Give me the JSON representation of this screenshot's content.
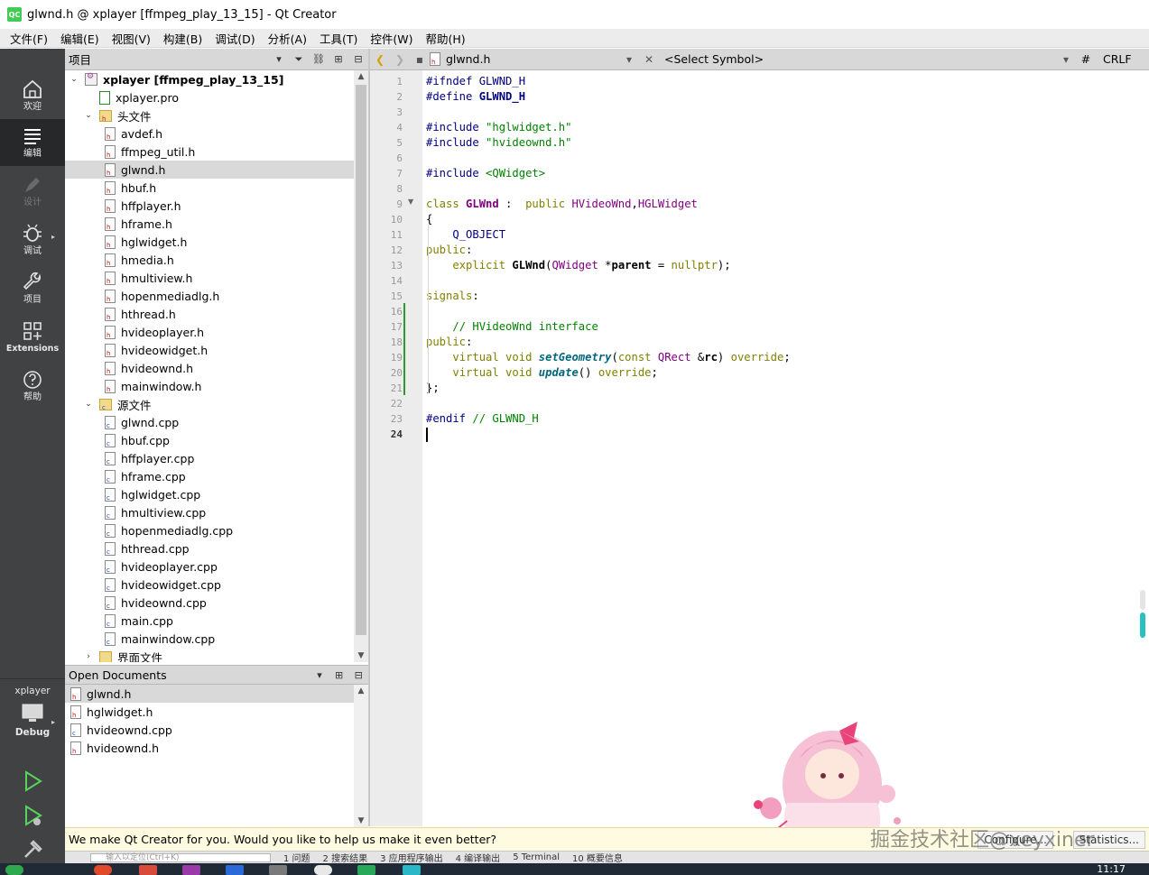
{
  "window": {
    "title": "glwnd.h @ xplayer [ffmpeg_play_13_15] - Qt Creator",
    "logo": "QC"
  },
  "menu": [
    "文件(F)",
    "编辑(E)",
    "视图(V)",
    "构建(B)",
    "调试(D)",
    "分析(A)",
    "工具(T)",
    "控件(W)",
    "帮助(H)"
  ],
  "modes": {
    "welcome": "欢迎",
    "edit": "编辑",
    "design": "设计",
    "debug": "调试",
    "projects": "项目",
    "extensions": "Extensions",
    "help": "帮助"
  },
  "kit": {
    "project": "xplayer",
    "config": "Debug"
  },
  "project_pane": {
    "header": "项目",
    "rows": [
      {
        "label": "xplayer [ffmpeg_play_13_15]",
        "kind": "project",
        "depth": 0,
        "expanded": true
      },
      {
        "label": "xplayer.pro",
        "kind": "pro",
        "depth": 1
      },
      {
        "label": "头文件",
        "kind": "folder-h",
        "depth": 1,
        "expanded": true
      },
      {
        "label": "avdef.h",
        "kind": "h",
        "depth": 2
      },
      {
        "label": "ffmpeg_util.h",
        "kind": "h",
        "depth": 2
      },
      {
        "label": "glwnd.h",
        "kind": "h",
        "depth": 2,
        "selected": true
      },
      {
        "label": "hbuf.h",
        "kind": "h",
        "depth": 2
      },
      {
        "label": "hffplayer.h",
        "kind": "h",
        "depth": 2
      },
      {
        "label": "hframe.h",
        "kind": "h",
        "depth": 2
      },
      {
        "label": "hglwidget.h",
        "kind": "h",
        "depth": 2
      },
      {
        "label": "hmedia.h",
        "kind": "h",
        "depth": 2
      },
      {
        "label": "hmultiview.h",
        "kind": "h",
        "depth": 2
      },
      {
        "label": "hopenmediadlg.h",
        "kind": "h",
        "depth": 2
      },
      {
        "label": "hthread.h",
        "kind": "h",
        "depth": 2
      },
      {
        "label": "hvideoplayer.h",
        "kind": "h",
        "depth": 2
      },
      {
        "label": "hvideowidget.h",
        "kind": "h",
        "depth": 2
      },
      {
        "label": "hvideownd.h",
        "kind": "h",
        "depth": 2
      },
      {
        "label": "mainwindow.h",
        "kind": "h",
        "depth": 2
      },
      {
        "label": "源文件",
        "kind": "folder-cpp",
        "depth": 1,
        "expanded": true
      },
      {
        "label": "glwnd.cpp",
        "kind": "cpp",
        "depth": 2
      },
      {
        "label": "hbuf.cpp",
        "kind": "cpp",
        "depth": 2
      },
      {
        "label": "hffplayer.cpp",
        "kind": "cpp",
        "depth": 2
      },
      {
        "label": "hframe.cpp",
        "kind": "cpp",
        "depth": 2
      },
      {
        "label": "hglwidget.cpp",
        "kind": "cpp",
        "depth": 2
      },
      {
        "label": "hmultiview.cpp",
        "kind": "cpp",
        "depth": 2
      },
      {
        "label": "hopenmediadlg.cpp",
        "kind": "cpp",
        "depth": 2
      },
      {
        "label": "hthread.cpp",
        "kind": "cpp",
        "depth": 2
      },
      {
        "label": "hvideoplayer.cpp",
        "kind": "cpp",
        "depth": 2
      },
      {
        "label": "hvideowidget.cpp",
        "kind": "cpp",
        "depth": 2
      },
      {
        "label": "hvideownd.cpp",
        "kind": "cpp",
        "depth": 2
      },
      {
        "label": "main.cpp",
        "kind": "cpp",
        "depth": 2
      },
      {
        "label": "mainwindow.cpp",
        "kind": "cpp",
        "depth": 2
      },
      {
        "label": "界面文件",
        "kind": "folder-ui",
        "depth": 1,
        "expanded": false
      }
    ]
  },
  "open_documents": {
    "header": "Open Documents",
    "items": [
      {
        "label": "glwnd.h",
        "kind": "h",
        "selected": true
      },
      {
        "label": "hglwidget.h",
        "kind": "h"
      },
      {
        "label": "hvideownd.cpp",
        "kind": "cpp"
      },
      {
        "label": "hvideownd.h",
        "kind": "h"
      }
    ]
  },
  "editor_toolbar": {
    "filename": "glwnd.h",
    "symbol": "<Select Symbol>",
    "hash": "#",
    "line_ending": "CRLF"
  },
  "editor": {
    "current_line": 24,
    "lines": [
      [
        [
          "mac",
          "#ifndef"
        ],
        [
          "",
          ""
        ],
        [
          "mac",
          " GLWND_H"
        ]
      ],
      [
        [
          "mac",
          "#define"
        ],
        [
          "mac bold",
          " GLWND_H"
        ]
      ],
      [],
      [
        [
          "mac",
          "#include"
        ],
        [
          "str",
          " \"hglwidget.h\""
        ]
      ],
      [
        [
          "mac",
          "#include"
        ],
        [
          "str",
          " \"hvideownd.h\""
        ]
      ],
      [],
      [
        [
          "mac",
          "#include"
        ],
        [
          "str",
          " <QWidget>"
        ]
      ],
      [],
      [
        [
          "kw",
          "class"
        ],
        [
          "type bold",
          " GLWnd"
        ],
        [
          "",
          " :  "
        ],
        [
          "kw",
          "public"
        ],
        [
          "type",
          " HVideoWnd"
        ],
        [
          "",
          ","
        ],
        [
          "type",
          "HGLWidget"
        ]
      ],
      [
        [
          "",
          "{"
        ]
      ],
      [
        [
          "",
          "    "
        ],
        [
          "mac",
          "Q_OBJECT"
        ]
      ],
      [
        [
          "kw",
          "public"
        ],
        [
          "",
          ":"
        ]
      ],
      [
        [
          "",
          "    "
        ],
        [
          "kw",
          "explicit"
        ],
        [
          "bold",
          " GLWnd"
        ],
        [
          "",
          "("
        ],
        [
          "type",
          "QWidget"
        ],
        [
          "",
          " *"
        ],
        [
          "bold",
          "parent"
        ],
        [
          "",
          " = "
        ],
        [
          "kw",
          "nullptr"
        ],
        [
          "",
          ");"
        ]
      ],
      [],
      [
        [
          "kw",
          "signals"
        ],
        [
          "",
          ":"
        ]
      ],
      [],
      [
        [
          "",
          "    "
        ],
        [
          "cmt",
          "// HVideoWnd interface"
        ]
      ],
      [
        [
          "kw",
          "public"
        ],
        [
          "",
          ":"
        ]
      ],
      [
        [
          "",
          "    "
        ],
        [
          "kw",
          "virtual void"
        ],
        [
          "",
          " "
        ],
        [
          "fn-italic",
          "setGeometry"
        ],
        [
          "",
          "("
        ],
        [
          "kw",
          "const"
        ],
        [
          "type",
          " QRect"
        ],
        [
          "",
          " &"
        ],
        [
          "bold",
          "rc"
        ],
        [
          "",
          ") "
        ],
        [
          "kw",
          "override"
        ],
        [
          "",
          ";"
        ]
      ],
      [
        [
          "",
          "    "
        ],
        [
          "kw",
          "virtual void"
        ],
        [
          "",
          " "
        ],
        [
          "fn-italic",
          "update"
        ],
        [
          "",
          "() "
        ],
        [
          "kw",
          "override"
        ],
        [
          "",
          ";"
        ]
      ],
      [
        [
          "",
          "};"
        ]
      ],
      [],
      [
        [
          "mac",
          "#endif"
        ],
        [
          "cmt",
          " // GLWND_H"
        ]
      ],
      []
    ]
  },
  "infobar": {
    "text": "We make Qt Creator for you. Would you like to help us make it even better?",
    "configure": "Configure...",
    "stats": "Statistics..."
  },
  "watermark": "掘金技术社区@xeyxiner",
  "output_tabs": [
    "1 问题",
    "2 搜索结果",
    "3 应用程序输出",
    "4 编译输出",
    "5 Terminal",
    "10 概要信息"
  ],
  "locator_placeholder": "输入以定位(Ctrl+K)",
  "clock": "11:17",
  "colors": {
    "modebar": "#404244",
    "accent_green": "#41cd52",
    "change_bar": "#2e9a2e"
  }
}
